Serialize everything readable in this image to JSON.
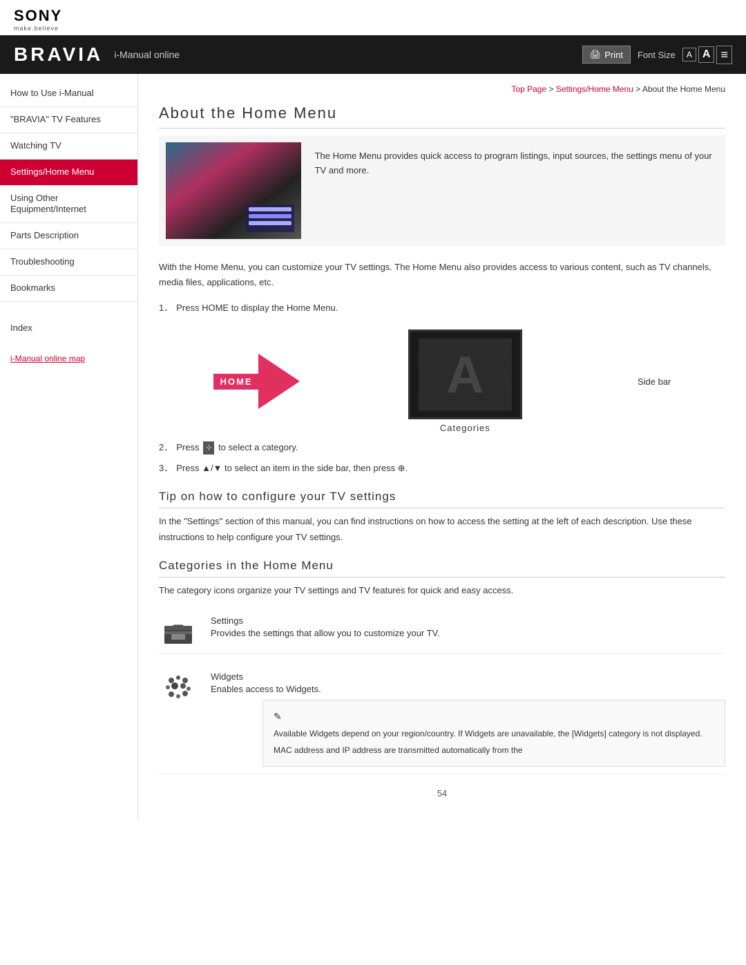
{
  "sony": {
    "logo": "SONY",
    "tagline": "make.believe"
  },
  "header": {
    "bravia_logo": "BRAVIA",
    "subtitle": "i-Manual online",
    "print_label": "Print",
    "font_size_label": "Font Size",
    "font_small": "A",
    "font_large": "A",
    "font_lines": "≡"
  },
  "breadcrumb": {
    "top_page": "Top Page",
    "settings_home_menu": "Settings/Home Menu",
    "current": "About the Home Menu",
    "sep1": ">",
    "sep2": ">"
  },
  "sidebar": {
    "items": [
      {
        "label": "How to Use i-Manual",
        "active": false
      },
      {
        "label": "\"BRAVIA\" TV Features",
        "active": false
      },
      {
        "label": "Watching TV",
        "active": false
      },
      {
        "label": "Settings/Home Menu",
        "active": true
      },
      {
        "label": "Using Other Equipment/Internet",
        "active": false
      },
      {
        "label": "Parts Description",
        "active": false
      },
      {
        "label": "Troubleshooting",
        "active": false
      },
      {
        "label": "Bookmarks",
        "active": false
      }
    ],
    "index_label": "Index",
    "map_link": "i-Manual online map"
  },
  "content": {
    "page_title": "About the Home Menu",
    "intro_text": "The Home Menu provides quick access to program listings, input sources, the settings menu of your TV and more.",
    "body_text": "With the Home Menu, you can customize your TV settings. The Home Menu also provides access to various content, such as TV channels, media files, applications, etc.",
    "steps": [
      {
        "num": "1．",
        "text": "Press HOME to display the Home Menu."
      },
      {
        "num": "2．",
        "text": "Press   to select a category."
      },
      {
        "num": "3．",
        "text": "Press ▲/▼ to select an item in the side bar, then press ⊕."
      }
    ],
    "home_label": "HOME",
    "sidebar_label": "Side bar",
    "categories_label": "Categories",
    "tip_heading": "Tip on how to configure your TV settings",
    "tip_text": "In the \"Settings\" section of this manual, you can find instructions on how to access the setting at the left of each description. Use these instructions to help configure your TV settings.",
    "categories_heading": "Categories in the Home Menu",
    "categories_intro": "The category icons organize your TV settings and TV features for quick and easy access.",
    "categories": [
      {
        "name": "Settings",
        "desc": "Provides the settings that allow you to customize your TV."
      },
      {
        "name": "Widgets",
        "desc": "Enables access to Widgets."
      }
    ],
    "note_lines": [
      "Available Widgets depend on your region/country. If Widgets are unavailable, the [Widgets] category is not displayed.",
      "MAC address and IP address are transmitted automatically from the"
    ],
    "page_number": "54"
  }
}
